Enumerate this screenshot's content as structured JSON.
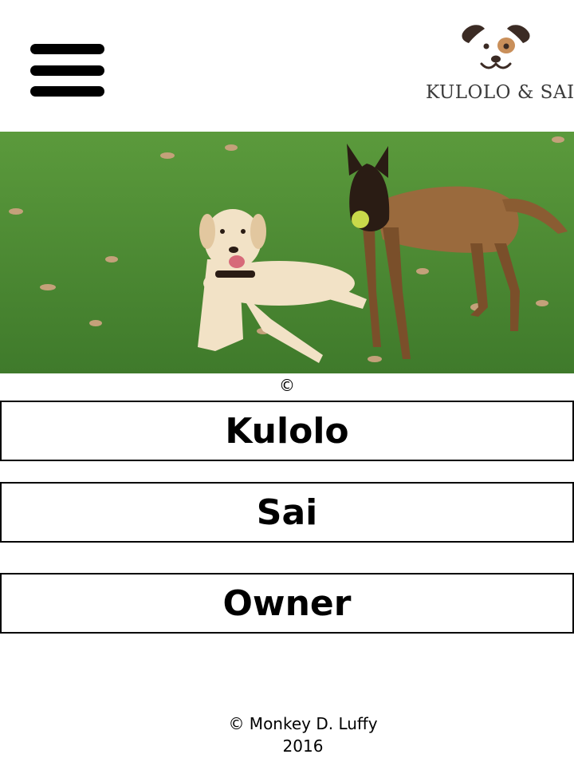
{
  "header": {
    "menu_icon": "hamburger-menu-icon",
    "logo": {
      "icon": "dog-face-icon",
      "text": "KULOLO & SAI"
    }
  },
  "hero": {
    "image": "two-dogs-on-grass-photo",
    "caption": "©"
  },
  "nav": [
    {
      "label": "Kulolo"
    },
    {
      "label": "Sai"
    },
    {
      "label": "Owner"
    }
  ],
  "footer": {
    "line1": "© Monkey D. Luffy",
    "line2": "2016"
  },
  "colors": {
    "background": "#ffffff",
    "text": "#000000",
    "logo_text": "#3a3a3a",
    "grass": "#4f8a34"
  }
}
